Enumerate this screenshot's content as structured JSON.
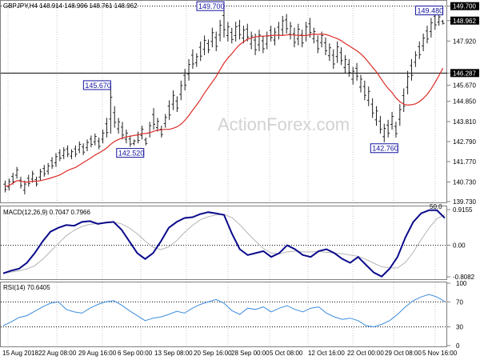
{
  "colors": {
    "candle": "#1f1f1f",
    "ma_line": "#dc2d28",
    "macd_line": "#0a0a8c",
    "macd_signal": "#b4b4b4",
    "rsi_line": "#3c8cdc",
    "annotation": "#1414a0",
    "watermark": "#d2d2d2"
  },
  "header": {
    "title": "GBPJPY,H4  148.914 148.996 148.761 148.962"
  },
  "watermark": {
    "text": "ActionForex.com"
  },
  "price_pane": {
    "axis_labels": [
      "149.700",
      "148.962",
      "147.920",
      "146.287",
      "145.670",
      "144.850",
      "143.810",
      "142.790",
      "141.770",
      "140.730",
      "139.730"
    ],
    "tags": {
      "high_line": "149.700",
      "current_price": "148.962",
      "level_line": "146.287"
    },
    "annotations": [
      {
        "label": "149.700"
      },
      {
        "label": "149.480"
      },
      {
        "label": "145.670"
      },
      {
        "label": "142.520"
      },
      {
        "label": "142.760"
      }
    ],
    "fib_label": "50.0"
  },
  "macd_pane": {
    "label": "MACD(12,26,9) 0.7047 0.7966",
    "axis_labels": [
      "0.9155",
      "0.00",
      "-0.8082"
    ]
  },
  "rsi_pane": {
    "label": "RSI(14) 70.6405",
    "axis_labels": [
      "100",
      "70",
      "30",
      "0"
    ]
  },
  "x_axis": {
    "labels": [
      "15 Aug 2018",
      "22 Aug 08:00",
      "29 Aug 16:00",
      "6 Sep 00:00",
      "13 Sep 08:00",
      "20 Sep 16:00",
      "28 Sep 00:00",
      "5 Oct 08:00",
      "12 Oct 16:00",
      "22 Oct 00:00",
      "29 Oct 08:00",
      "5 Nov 16:00"
    ]
  },
  "chart_data": [
    {
      "type": "candlestick",
      "title": "GBPJPY,H4  148.914 148.996 148.761 148.962",
      "ylim": [
        139.73,
        149.85
      ],
      "series": [
        {
          "name": "GBPJPY",
          "points": [
            [
              140.8,
              140.2
            ],
            [
              140.9,
              140.3
            ],
            [
              141.2,
              140.6
            ],
            [
              141.5,
              140.9
            ],
            [
              141.0,
              140.4
            ],
            [
              140.8,
              140.1
            ],
            [
              141.1,
              140.5
            ],
            [
              141.3,
              140.7
            ],
            [
              141.0,
              140.5
            ],
            [
              141.4,
              140.8
            ],
            [
              141.6,
              141.0
            ],
            [
              141.7,
              141.1
            ],
            [
              142.0,
              141.4
            ],
            [
              142.2,
              141.5
            ],
            [
              142.4,
              141.8
            ],
            [
              142.5,
              141.9
            ],
            [
              142.6,
              142.0
            ],
            [
              142.4,
              141.9
            ],
            [
              142.6,
              142.0
            ],
            [
              142.8,
              142.2
            ],
            [
              142.7,
              142.1
            ],
            [
              142.9,
              142.3
            ],
            [
              143.1,
              142.5
            ],
            [
              143.2,
              142.6
            ],
            [
              143.0,
              142.4
            ],
            [
              143.4,
              142.7
            ],
            [
              144.0,
              143.0
            ],
            [
              145.67,
              143.2
            ],
            [
              144.6,
              143.5
            ],
            [
              144.0,
              143.2
            ],
            [
              143.8,
              142.9
            ],
            [
              143.4,
              142.7
            ],
            [
              143.1,
              142.52
            ],
            [
              142.9,
              142.6
            ],
            [
              143.3,
              142.7
            ],
            [
              143.6,
              142.9
            ],
            [
              143.0,
              142.6
            ],
            [
              143.8,
              143.0
            ],
            [
              144.5,
              143.4
            ],
            [
              144.0,
              143.3
            ],
            [
              143.6,
              143.0
            ],
            [
              144.2,
              143.5
            ],
            [
              144.9,
              143.9
            ],
            [
              145.4,
              144.4
            ],
            [
              145.1,
              144.3
            ],
            [
              145.9,
              144.9
            ],
            [
              146.5,
              145.4
            ],
            [
              147.0,
              145.9
            ],
            [
              147.5,
              146.5
            ],
            [
              147.3,
              146.6
            ],
            [
              147.9,
              146.9
            ],
            [
              148.2,
              147.2
            ],
            [
              148.0,
              147.3
            ],
            [
              148.6,
              147.6
            ],
            [
              148.4,
              147.4
            ],
            [
              149.0,
              147.9
            ],
            [
              149.7,
              148.1
            ],
            [
              148.9,
              147.9
            ],
            [
              148.6,
              147.8
            ],
            [
              148.9,
              147.9
            ],
            [
              149.0,
              148.0
            ],
            [
              148.7,
              147.8
            ],
            [
              148.8,
              147.9
            ],
            [
              148.4,
              147.5
            ],
            [
              148.3,
              147.2
            ],
            [
              148.5,
              147.4
            ],
            [
              148.2,
              147.3
            ],
            [
              148.4,
              147.5
            ],
            [
              148.7,
              147.9
            ],
            [
              148.6,
              147.7
            ],
            [
              148.9,
              148.0
            ],
            [
              149.2,
              148.2
            ],
            [
              149.3,
              148.3
            ],
            [
              148.9,
              148.0
            ],
            [
              148.6,
              147.6
            ],
            [
              148.8,
              147.7
            ],
            [
              148.5,
              147.6
            ],
            [
              148.9,
              147.9
            ],
            [
              149.1,
              148.1
            ],
            [
              148.6,
              147.8
            ],
            [
              148.2,
              147.3
            ],
            [
              148.4,
              147.6
            ],
            [
              148.1,
              147.2
            ],
            [
              147.8,
              146.9
            ],
            [
              147.5,
              146.5
            ],
            [
              147.9,
              146.8
            ],
            [
              147.6,
              146.7
            ],
            [
              147.2,
              146.3
            ],
            [
              147.0,
              146.1
            ],
            [
              146.6,
              145.7
            ],
            [
              146.8,
              145.9
            ],
            [
              146.2,
              145.3
            ],
            [
              145.9,
              144.9
            ],
            [
              145.6,
              144.6
            ],
            [
              145.0,
              144.0
            ],
            [
              144.6,
              143.6
            ],
            [
              144.1,
              143.2
            ],
            [
              143.7,
              142.76
            ],
            [
              143.9,
              143.0
            ],
            [
              144.3,
              143.4
            ],
            [
              143.8,
              143.0
            ],
            [
              144.7,
              143.6
            ],
            [
              145.5,
              144.3
            ],
            [
              146.4,
              145.2
            ],
            [
              147.0,
              145.9
            ],
            [
              147.4,
              146.6
            ],
            [
              147.9,
              147.0
            ],
            [
              148.3,
              147.4
            ],
            [
              148.7,
              147.8
            ],
            [
              149.1,
              148.1
            ],
            [
              149.48,
              148.5
            ],
            [
              149.3,
              148.7
            ],
            [
              148.996,
              148.761
            ]
          ]
        }
      ]
    },
    {
      "type": "line",
      "title": "MACD(12,26,9) 0.7047 0.7966",
      "ylim": [
        -0.8082,
        0.9155
      ],
      "series": [
        {
          "values": [
            -0.72,
            -0.65,
            -0.6,
            -0.45,
            -0.2,
            0.1,
            0.35,
            0.45,
            0.52,
            0.5,
            0.6,
            0.62,
            0.55,
            0.58,
            0.6,
            0.4,
            0.1,
            -0.2,
            -0.35,
            -0.2,
            0.1,
            0.45,
            0.6,
            0.7,
            0.72,
            0.8,
            0.85,
            0.82,
            0.78,
            0.3,
            -0.1,
            -0.25,
            -0.2,
            -0.15,
            -0.3,
            -0.2,
            0.0,
            -0.1,
            -0.25,
            -0.3,
            -0.15,
            -0.1,
            -0.2,
            -0.35,
            -0.45,
            -0.3,
            -0.5,
            -0.7,
            -0.8,
            -0.6,
            -0.3,
            0.2,
            0.6,
            0.82,
            0.9,
            0.9,
            0.7
          ]
        }
      ]
    },
    {
      "type": "line",
      "title": "RSI(14) 70.6405",
      "ylim": [
        0,
        100
      ],
      "series": [
        {
          "values": [
            32,
            38,
            45,
            48,
            55,
            62,
            68,
            70,
            58,
            54,
            52,
            60,
            66,
            70,
            72,
            65,
            56,
            48,
            40,
            44,
            46,
            50,
            55,
            52,
            60,
            66,
            70,
            74,
            68,
            56,
            50,
            60,
            58,
            62,
            54,
            60,
            64,
            58,
            54,
            60,
            62,
            52,
            46,
            42,
            44,
            40,
            32,
            30,
            34,
            40,
            50,
            62,
            72,
            78,
            82,
            78,
            70.64
          ]
        }
      ]
    }
  ]
}
